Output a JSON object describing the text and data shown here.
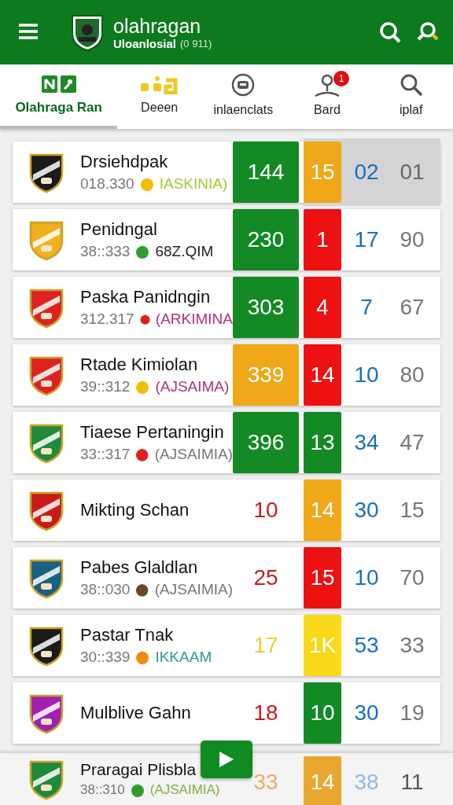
{
  "header": {
    "title": "olahragan",
    "subtitle": "Uloanlosial",
    "subtitle_note": "(0 911)"
  },
  "tabs": [
    {
      "label": "Olahraga Ran",
      "kind": "teams",
      "selected": true
    },
    {
      "label": "Deeen",
      "kind": "dots",
      "selected": false
    },
    {
      "label": "inlaenclats",
      "kind": "robot",
      "selected": false
    },
    {
      "label": "Bard",
      "kind": "person",
      "selected": false,
      "badge": "1"
    },
    {
      "label": "iplaf",
      "kind": "search",
      "selected": false
    }
  ],
  "rows": [
    {
      "name": "Drsiehdpak",
      "color": "#1a1a1a",
      "highlighted": true,
      "meta": {
        "time": "018.330",
        "icon": {
          "color": "#f0c000"
        },
        "tag": {
          "text": "IASKINIA)",
          "color": "#9acd32"
        }
      },
      "scores": [
        {
          "value": "144",
          "kind": "box",
          "color": "#138a24"
        },
        {
          "value": "15",
          "kind": "box",
          "color": "#f0a818"
        },
        {
          "value": "02",
          "kind": "plain",
          "color": "#1570c0"
        },
        {
          "value": "01",
          "kind": "plain",
          "color": "#666666"
        }
      ]
    },
    {
      "name": "Penidngal",
      "color": "#f0b020",
      "highlighted": false,
      "meta": {
        "time": "38::333",
        "icon": {
          "color": "#2e9e2e"
        },
        "tag": {
          "text": "68Z.QIM",
          "color": "#222222"
        }
      },
      "scores": [
        {
          "value": "230",
          "kind": "box",
          "color": "#138a24"
        },
        {
          "value": "1",
          "kind": "box",
          "color": "#ee1111"
        },
        {
          "value": "17",
          "kind": "plain",
          "color": "#1570c0"
        },
        {
          "value": "90",
          "kind": "plain",
          "color": "#777777"
        }
      ]
    },
    {
      "name": "Paska Panidngin",
      "color": "#dd2222",
      "highlighted": false,
      "meta": {
        "time": "312.317",
        "icon": {
          "color": "#e02020"
        },
        "tag": {
          "text": "(ARKIMINA",
          "color": "#b0307a"
        }
      },
      "scores": [
        {
          "value": "303",
          "kind": "box",
          "color": "#138a24"
        },
        {
          "value": "4",
          "kind": "box",
          "color": "#ee1111"
        },
        {
          "value": "7",
          "kind": "plain",
          "color": "#1570c0"
        },
        {
          "value": "67",
          "kind": "plain",
          "color": "#777777"
        }
      ]
    },
    {
      "name": "Rtade Kimiolan",
      "color": "#dd2222",
      "highlighted": false,
      "meta": {
        "time": "39::312",
        "icon": {
          "color": "#f0c000"
        },
        "tag": {
          "text": "(AJSAIMA)",
          "color": "#b0307a"
        }
      },
      "scores": [
        {
          "value": "339",
          "kind": "box",
          "color": "#f0a818"
        },
        {
          "value": "14",
          "kind": "box",
          "color": "#ee1111"
        },
        {
          "value": "10",
          "kind": "plain",
          "color": "#1570c0"
        },
        {
          "value": "80",
          "kind": "plain",
          "color": "#777777"
        }
      ]
    },
    {
      "name": "Tiaese Pertaningin",
      "color": "#1f8a3a",
      "highlighted": false,
      "meta": {
        "time": "33::317",
        "icon": {
          "color": "#e02020"
        },
        "tag": {
          "text": "(AJSAIMIA)",
          "color": "#777777"
        }
      },
      "scores": [
        {
          "value": "396",
          "kind": "box",
          "color": "#138a24"
        },
        {
          "value": "13",
          "kind": "box",
          "color": "#138a24"
        },
        {
          "value": "34",
          "kind": "plain",
          "color": "#1570c0"
        },
        {
          "value": "47",
          "kind": "plain",
          "color": "#777777"
        }
      ]
    },
    {
      "name": "Mikting Schan",
      "color": "#cc1a1a",
      "highlighted": false,
      "scores": [
        {
          "value": "10",
          "kind": "plain",
          "color": "#cc1a1a"
        },
        {
          "value": "14",
          "kind": "box",
          "color": "#f0a818"
        },
        {
          "value": "30",
          "kind": "plain",
          "color": "#1570c0"
        },
        {
          "value": "15",
          "kind": "plain",
          "color": "#777777"
        }
      ]
    },
    {
      "name": "Pabes Glaldlan",
      "color": "#1a6080",
      "highlighted": false,
      "meta": {
        "time": "38::030",
        "icon": {
          "color": "#6a4a20"
        },
        "tag": {
          "text": "(AJSAIMIA)",
          "color": "#777777"
        }
      },
      "scores": [
        {
          "value": "25",
          "kind": "plain",
          "color": "#cc1a1a"
        },
        {
          "value": "15",
          "kind": "box",
          "color": "#ee1111"
        },
        {
          "value": "10",
          "kind": "plain",
          "color": "#1570c0"
        },
        {
          "value": "70",
          "kind": "plain",
          "color": "#777777"
        }
      ]
    },
    {
      "name": "Pastar Tnak",
      "color": "#1a1a1a",
      "highlighted": false,
      "meta": {
        "time": "30::339",
        "icon": {
          "color": "#f08a10"
        },
        "tag": {
          "text": "IKKAAM",
          "color": "#2a9a8a"
        }
      },
      "scores": [
        {
          "value": "17",
          "kind": "plain",
          "color": "#e8d030"
        },
        {
          "value": "1K",
          "kind": "box",
          "color": "#f8d818"
        },
        {
          "value": "53",
          "kind": "plain",
          "color": "#1570c0"
        },
        {
          "value": "33",
          "kind": "plain",
          "color": "#777777"
        }
      ]
    },
    {
      "name": "Mulblive Gahn",
      "color": "#a020b0",
      "highlighted": false,
      "scores": [
        {
          "value": "18",
          "kind": "plain",
          "color": "#cc1a1a"
        },
        {
          "value": "10",
          "kind": "box",
          "color": "#138a24"
        },
        {
          "value": "30",
          "kind": "plain",
          "color": "#1570c0"
        },
        {
          "value": "19",
          "kind": "plain",
          "color": "#777777"
        }
      ]
    },
    {
      "name": "Praragai Plisbla",
      "color": "#1f8a3a",
      "highlighted": false,
      "meta": {
        "time": "38::310",
        "icon": {
          "color": "#2e9e2e"
        },
        "tag": {
          "text": "(AJSAIMIA)",
          "color": "#7ab040"
        }
      },
      "scores": [
        {
          "value": "33",
          "kind": "plain",
          "color": "#e8b060"
        },
        {
          "value": "14",
          "kind": "box",
          "color": "#e8a830"
        },
        {
          "value": "38",
          "kind": "plain",
          "color": "#90b8e0"
        },
        {
          "value": "11",
          "kind": "plain",
          "color": "#555555"
        }
      ]
    }
  ]
}
